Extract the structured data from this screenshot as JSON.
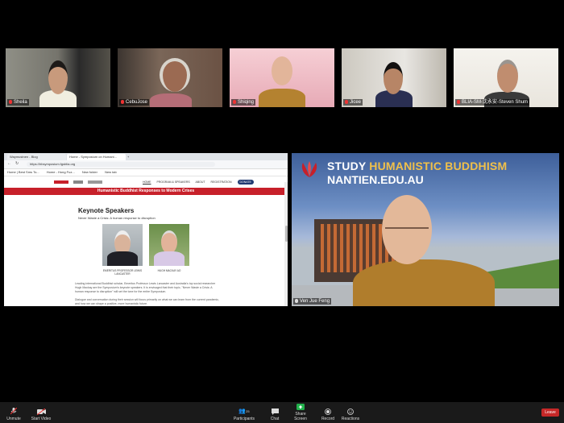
{
  "participants": [
    {
      "name": "Sheila"
    },
    {
      "name": "CebuJose"
    },
    {
      "name": "Shiqing"
    },
    {
      "name": "Jicee"
    },
    {
      "name": "BLIA-SM-沈永安-Steven Shum"
    }
  ],
  "browser": {
    "tabs": [
      "Waymustnen - Blog",
      "Home - Symposium on Humani..."
    ],
    "url": "https://hbsymposium.fgsblia.org",
    "bookmarks": [
      "Home | Best Sms To...",
      "Home - Hong Fuz...",
      "New folder",
      "New tab"
    ]
  },
  "website": {
    "nav": [
      "HOME",
      "PROGRAM & SPEAKERS",
      "ABOUT",
      "REGISTRATION"
    ],
    "donate": "DONATE",
    "banner": "Humanistic Buddhist Responses to Modern Crises",
    "heading": "Keynote Speakers",
    "subheading": "Never Waste a Crisis: A human response to disruption",
    "speakers": [
      {
        "caption": "EMERITUS PROFESSOR LEWIS LANCASTER"
      },
      {
        "caption": "HUGH MACKAY AO"
      }
    ],
    "para1": "Leading international Buddhist scholar, Emeritus Professor Lewis Lancaster and Australia's top social researcher Hugh Mackay are the Symposium's keynote speakers. It is envisaged that their topic, \"Never Waste a Crisis: A human response to disruption\" will set the tone for the entire Symposium.",
    "para2": "Dialogue and conversation during their session will focus primarily on what we can learn from the current pandemic, and how we can shape a positive, more humanistic future."
  },
  "speaker_view": {
    "banner_line1_white": "STUDY ",
    "banner_line1_gold": "HUMANISTIC BUDDHISM",
    "banner_line2": "NANTIEN.EDU.AU",
    "name": "Ven Jue Feng"
  },
  "toolbar": {
    "unmute": "Unmute",
    "start_video": "Start Video",
    "participants": "Participants",
    "participants_count": "25",
    "chat": "Chat",
    "share_screen": "Share Screen",
    "record": "Record",
    "reactions": "Reactions",
    "leave": "Leave"
  }
}
